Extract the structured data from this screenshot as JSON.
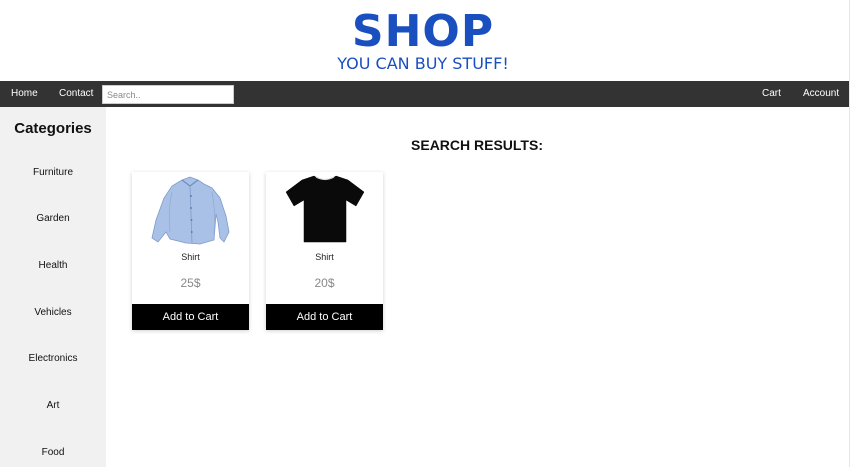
{
  "header": {
    "title": "SHOP",
    "tagline": "YOU CAN BUY STUFF!",
    "brand_color": "#1a4fbf"
  },
  "nav": {
    "home": "Home",
    "contact": "Contact",
    "search_placeholder": "Search..",
    "search_value": "",
    "cart": "Cart",
    "account": "Account",
    "background": "#333333"
  },
  "sidebar": {
    "title": "Categories",
    "items": [
      "Furniture",
      "Garden",
      "Health",
      "Vehicles",
      "Electronics",
      "Art",
      "Food"
    ]
  },
  "results": {
    "title": "SEARCH RESULTS:",
    "products": [
      {
        "image": "light-blue-shirt-image",
        "name": "Shirt",
        "price": "25$",
        "button": "Add to Cart"
      },
      {
        "image": "black-tshirt-image",
        "name": "Shirt",
        "price": "20$",
        "button": "Add to Cart"
      }
    ]
  }
}
